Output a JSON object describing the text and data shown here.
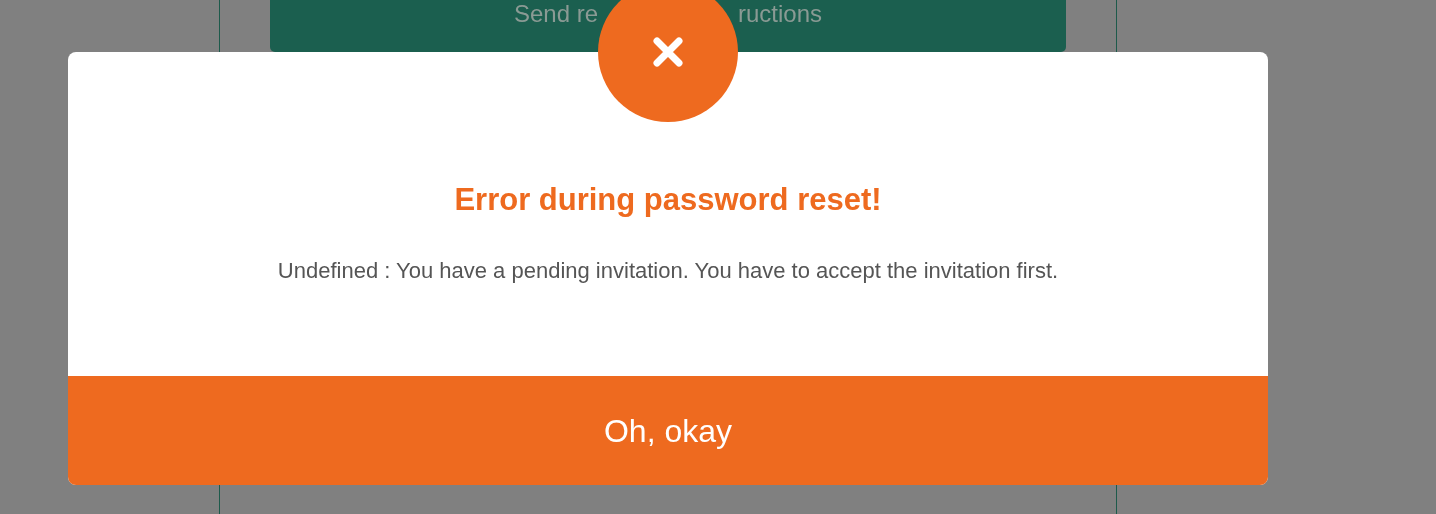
{
  "background_form": {
    "submit_button": {
      "text_left": "Send re",
      "text_right": "ructions"
    }
  },
  "dialog": {
    "title": "Error during password reset!",
    "message": "Undefined : You have a pending invitation. You have to accept the invitation first.",
    "button": "Oh, okay"
  }
}
